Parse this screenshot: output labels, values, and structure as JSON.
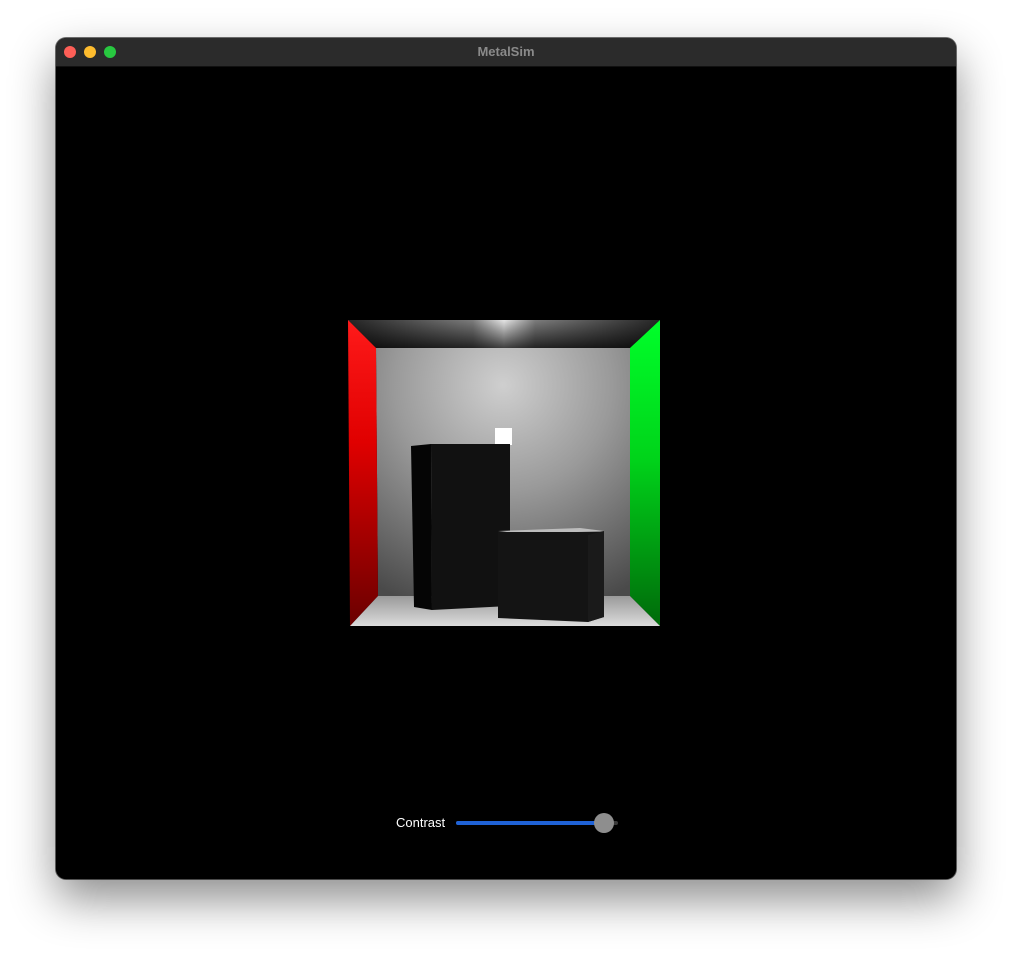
{
  "window": {
    "title": "MetalSim"
  },
  "controls": {
    "contrast_label": "Contrast",
    "contrast_value": 1.0,
    "accent_color": "#1f62d6"
  },
  "scene": {
    "left_wall_color": "#ff0000",
    "right_wall_color": "#00ff1a",
    "light_color": "#ffffff"
  }
}
